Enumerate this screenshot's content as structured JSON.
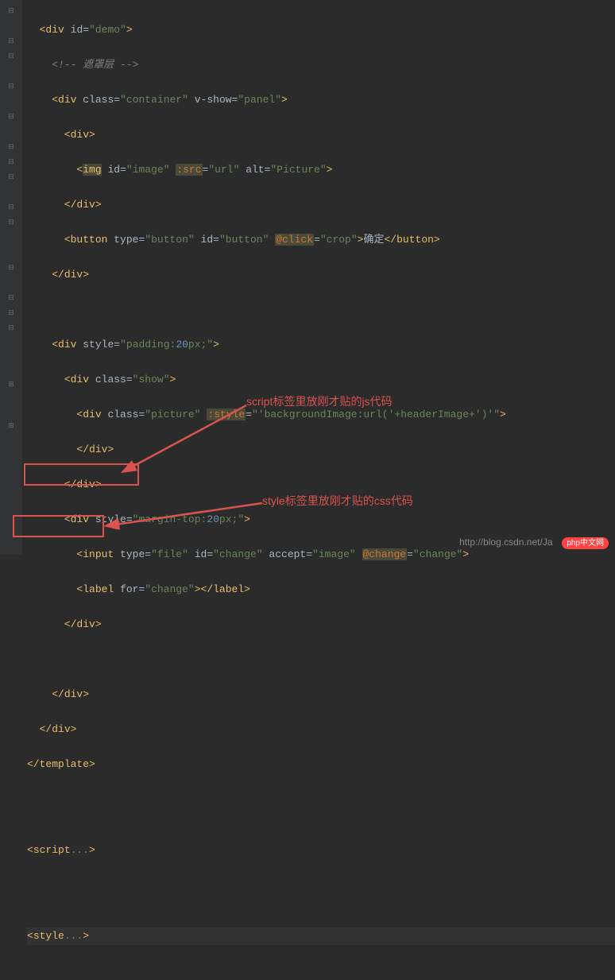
{
  "code": {
    "lines": [
      "  <div id=\"demo\">",
      "    <!-- 遮罩层 -->",
      "    <div class=\"container\" v-show=\"panel\">",
      "      <div>",
      "        <img id=\"image\" :src=\"url\" alt=\"Picture\">",
      "      </div>",
      "      <button type=\"button\" id=\"button\" @click=\"crop\">确定</button>",
      "    </div>",
      "",
      "    <div style=\"padding:20px;\">",
      "      <div class=\"show\">",
      "        <div class=\"picture\" :style=\"'backgroundImage:url('+headerImage+')'\">",
      "        </div>",
      "      </div>",
      "      <div style=\"margin-top:20px;\">",
      "        <input type=\"file\" id=\"change\" accept=\"image\" @change=\"change\">",
      "        <label for=\"change\"></label>",
      "      </div>",
      "",
      "    </div>",
      "  </div>",
      "</template>",
      "",
      "<script...>",
      "",
      "<style...>"
    ],
    "button_text": "确定"
  },
  "annotations": {
    "script_note": "script标签里放刚才贴的js代码",
    "style_note": "style标签里放刚才贴的css代码"
  },
  "watermark": {
    "url": "http://blog.csdn.net/Ja",
    "badge": "php中文网"
  }
}
